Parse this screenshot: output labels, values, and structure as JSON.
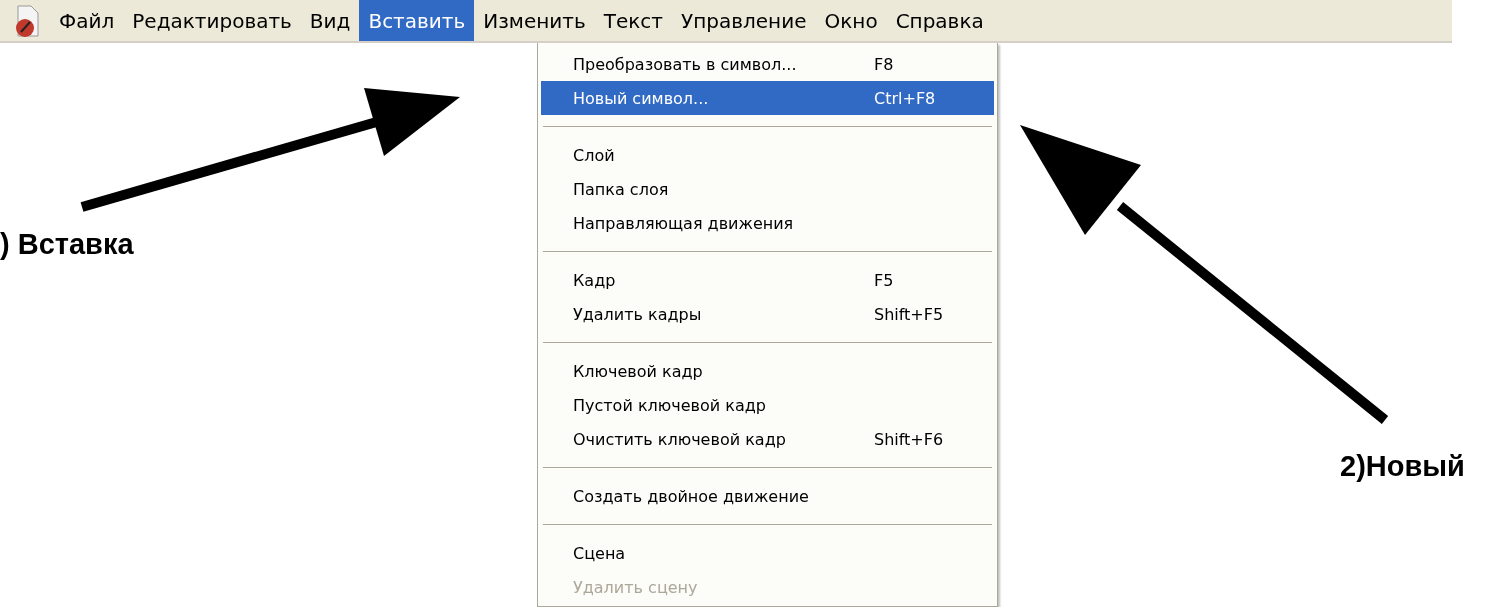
{
  "menubar": {
    "items": [
      {
        "label": "Файл",
        "selected": false
      },
      {
        "label": "Редактировать",
        "selected": false
      },
      {
        "label": "Вид",
        "selected": false
      },
      {
        "label": "Вставить",
        "selected": true
      },
      {
        "label": "Изменить",
        "selected": false
      },
      {
        "label": "Текст",
        "selected": false
      },
      {
        "label": "Управление",
        "selected": false
      },
      {
        "label": "Окно",
        "selected": false
      },
      {
        "label": "Справка",
        "selected": false
      }
    ]
  },
  "menu": {
    "items": [
      {
        "kind": "item",
        "label": "Преобразовать в символ...",
        "shortcut": "F8",
        "selected": false,
        "disabled": false
      },
      {
        "kind": "item",
        "label": "Новый символ...",
        "shortcut": "Ctrl+F8",
        "selected": true,
        "disabled": false
      },
      {
        "kind": "separator"
      },
      {
        "kind": "item",
        "label": "Слой",
        "selected": false,
        "disabled": false
      },
      {
        "kind": "item",
        "label": "Папка слоя",
        "selected": false,
        "disabled": false
      },
      {
        "kind": "item",
        "label": "Направляющая движения",
        "selected": false,
        "disabled": false
      },
      {
        "kind": "separator"
      },
      {
        "kind": "item",
        "label": "Кадр",
        "shortcut": "F5",
        "selected": false,
        "disabled": false
      },
      {
        "kind": "item",
        "label": "Удалить кадры",
        "shortcut": "Shift+F5",
        "selected": false,
        "disabled": false
      },
      {
        "kind": "separator"
      },
      {
        "kind": "item",
        "label": "Ключевой кадр",
        "selected": false,
        "disabled": false
      },
      {
        "kind": "item",
        "label": "Пустой ключевой кадр",
        "selected": false,
        "disabled": false
      },
      {
        "kind": "item",
        "label": "Очистить ключевой кадр",
        "shortcut": "Shift+F6",
        "selected": false,
        "disabled": false
      },
      {
        "kind": "separator"
      },
      {
        "kind": "item",
        "label": "Создать двойное движение",
        "selected": false,
        "disabled": false
      },
      {
        "kind": "separator"
      },
      {
        "kind": "item",
        "label": "Сцена",
        "selected": false,
        "disabled": false
      },
      {
        "kind": "item",
        "label": "Удалить сцену",
        "selected": false,
        "disabled": true
      }
    ]
  },
  "annotations": [
    {
      "label": ") Вставка"
    },
    {
      "label": "2)Новый"
    }
  ]
}
